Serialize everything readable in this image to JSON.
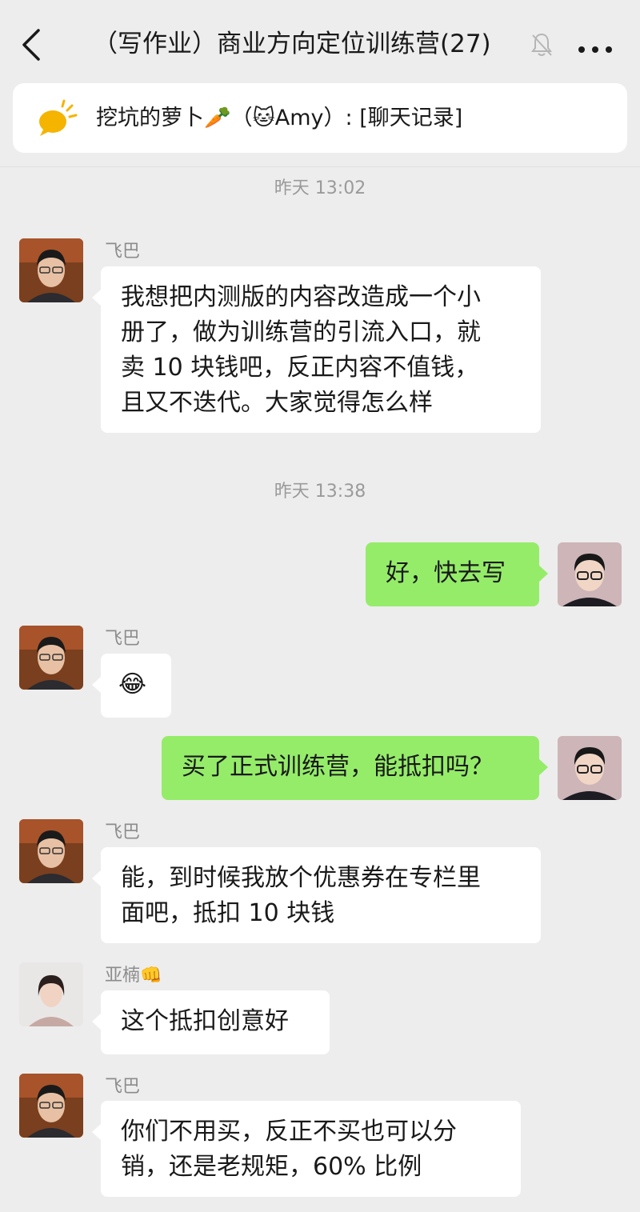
{
  "header": {
    "title": "（写作业）商业方向定位训练营(27)",
    "back_icon": "chevron-left-icon",
    "mute_icon": "bell-muted-icon",
    "more_icon": "more-dots-icon"
  },
  "banner": {
    "icon": "chat-bubble-icon",
    "text": "挖坑的萝卜🥕（🐱Amy）: [聊天记录]"
  },
  "timestamps": [
    "昨天 13:02",
    "昨天 13:38"
  ],
  "messages": [
    {
      "sender": "飞巴",
      "lines": [
        "我想把内测版的内容改造成一个小",
        "册了，做为训练营的引流入口，就",
        "卖 10 块钱吧，反正内容不值钱，",
        "且又不迭代。大家觉得怎么样"
      ]
    },
    {
      "lines": [
        "好，快去写"
      ]
    },
    {
      "sender": "飞巴",
      "emoji": "😂"
    },
    {
      "lines": [
        "买了正式训练营，能抵扣吗？"
      ]
    },
    {
      "sender": "飞巴",
      "lines": [
        "能，到时候我放个优惠券在专栏里",
        "面吧，抵扣 10 块钱"
      ]
    },
    {
      "sender": "亚楠👊",
      "lines": [
        "这个抵扣创意好"
      ]
    },
    {
      "sender": "飞巴",
      "lines": [
        "你们不用买，反正不买也可以分",
        "销，还是老规矩，60% 比例"
      ]
    }
  ],
  "colors": {
    "background": "#ededed",
    "incoming_bubble": "#ffffff",
    "outgoing_bubble": "#95ec69",
    "timestamp": "#9a9a9a",
    "sender": "#8c8c8c"
  }
}
